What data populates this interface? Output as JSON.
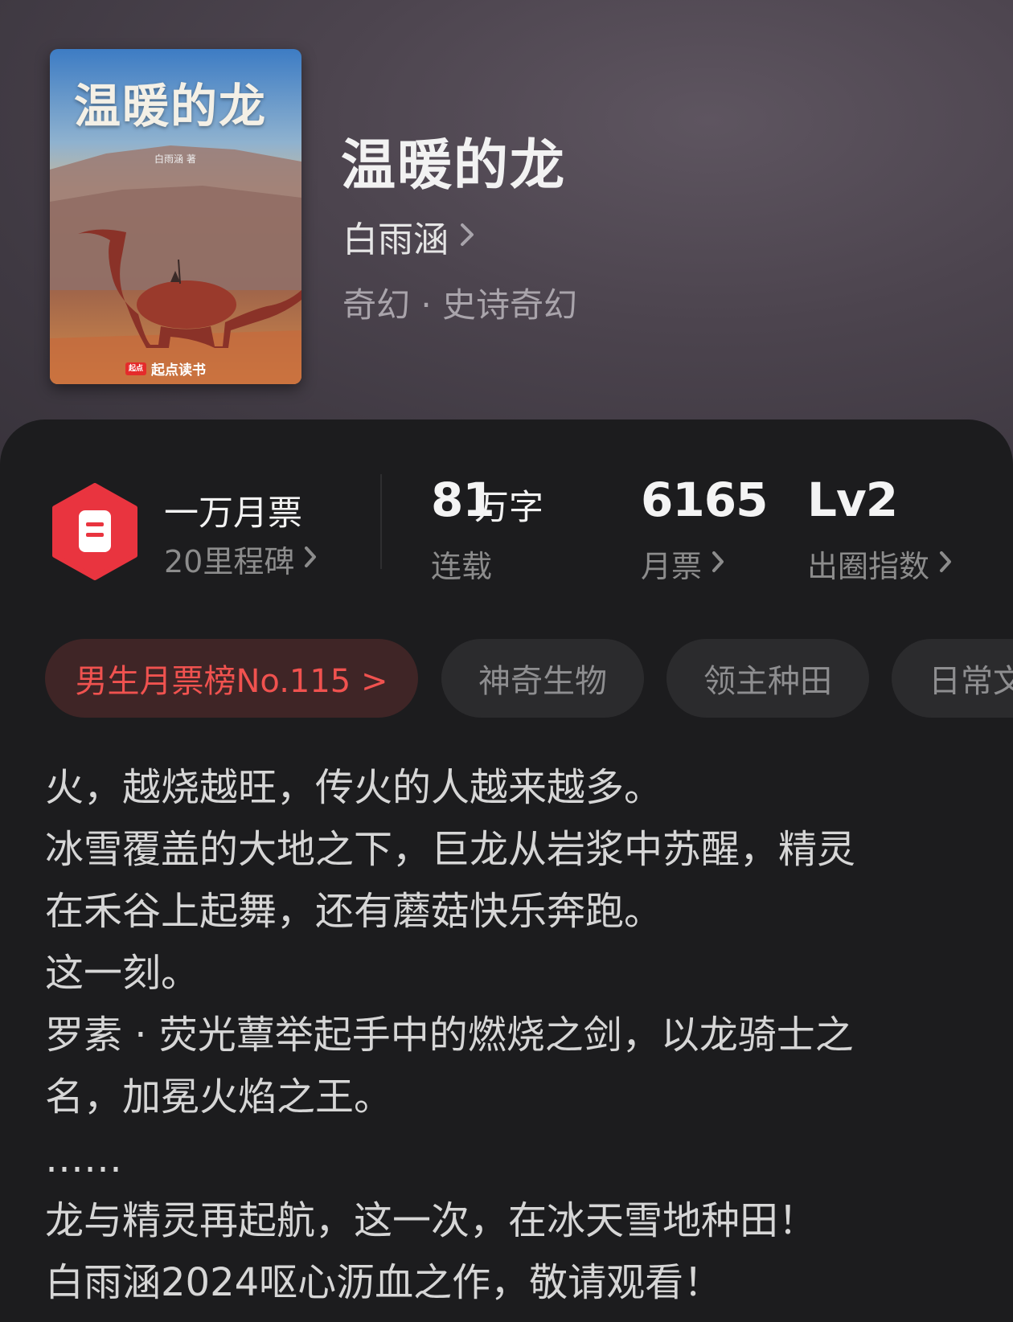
{
  "book": {
    "cover": {
      "title": "温暖的龙",
      "author_line": "白雨涵 著",
      "publisher": "起点读书",
      "publisher_logo": "起点"
    },
    "title": "温暖的龙",
    "author": "白雨涵",
    "genre": "奇幻 · 史诗奇幻"
  },
  "stats": {
    "milestone_title": "一万月票",
    "milestone_sub": "20里程碑",
    "word_count": "81",
    "word_unit": "万字",
    "status": "连载",
    "monthly_tickets": "6165",
    "monthly_tickets_label": "月票",
    "level": "Lv2",
    "level_label": "出圈指数"
  },
  "tags": [
    {
      "label": "男生月票榜No.115 >"
    },
    {
      "label": "神奇生物"
    },
    {
      "label": "领主种田"
    },
    {
      "label": "日常文"
    }
  ],
  "description": [
    "火，越烧越旺，传火的人越来越多。",
    "冰雪覆盖的大地之下，巨龙从岩浆中苏醒，精灵",
    "在禾谷上起舞，还有蘑菇快乐奔跑。",
    "这一刻。",
    "罗素 · 荧光蕈举起手中的燃烧之剑，以龙骑士之",
    "名，加冕火焰之王。",
    "……",
    "龙与精灵再起航，这一次，在冰天雪地种田！",
    "白雨涵2024呕心沥血之作，敬请观看！"
  ],
  "colors": {
    "accent_red": "#f0524f",
    "badge_red": "#e9343f",
    "panel_bg": "#1c1c1e"
  },
  "icons": {
    "badge": "ticket-badge-icon",
    "chevron": "chevron-right-icon"
  }
}
